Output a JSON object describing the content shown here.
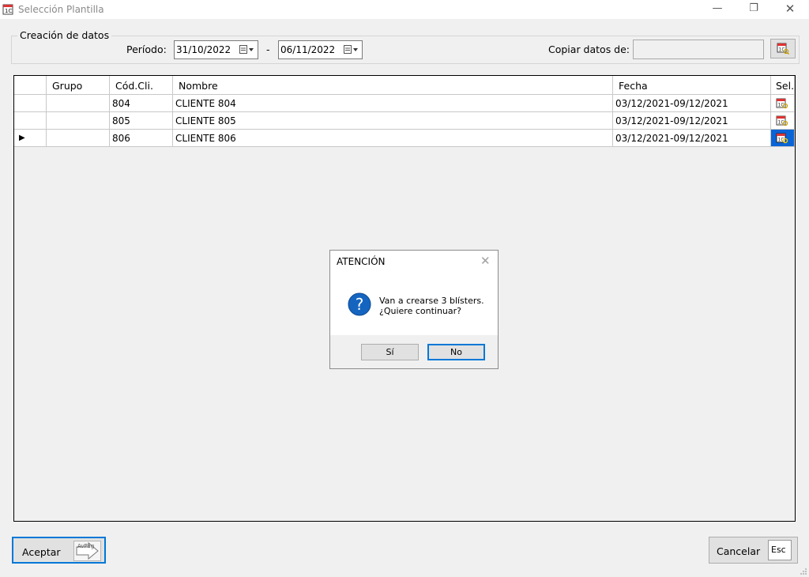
{
  "window": {
    "title": "Selección Plantilla",
    "controls": {
      "minimize": "—",
      "restore": "❐",
      "close": "✕"
    }
  },
  "form": {
    "group_title": "Creación de datos",
    "period_label": "Período:",
    "date_from": "31/10/2022",
    "range_separator": "-",
    "date_to": "06/11/2022",
    "copy_label": "Copiar datos de:",
    "copy_value": ""
  },
  "grid": {
    "columns": [
      "Grupo",
      "Cód.Cli.",
      "Nombre",
      "Fecha",
      "Sel."
    ],
    "rows": [
      {
        "indicator": "",
        "grupo": "",
        "cod": "804",
        "nombre": "CLIENTE 804",
        "fecha": "03/12/2021-09/12/2021"
      },
      {
        "indicator": "",
        "grupo": "",
        "cod": "805",
        "nombre": "CLIENTE 805",
        "fecha": "03/12/2021-09/12/2021"
      },
      {
        "indicator": "▶",
        "grupo": "",
        "cod": "806",
        "nombre": "CLIENTE 806",
        "fecha": "03/12/2021-09/12/2021"
      }
    ],
    "selected_row": 3
  },
  "dialog": {
    "title": "ATENCIÓN",
    "close": "✕",
    "line1": "Van a crearse 3 blísters.",
    "line2": "¿Quiere continuar?",
    "yes_label": "Sí",
    "no_label": "No",
    "icon": "question-icon"
  },
  "footer": {
    "accept_label": "Aceptar",
    "accept_key": "AvPág",
    "cancel_label": "Cancelar",
    "cancel_key": "Esc"
  },
  "colors": {
    "accent": "#0078d7",
    "selection": "#0a64d6",
    "question_icon": "#1565c0"
  }
}
